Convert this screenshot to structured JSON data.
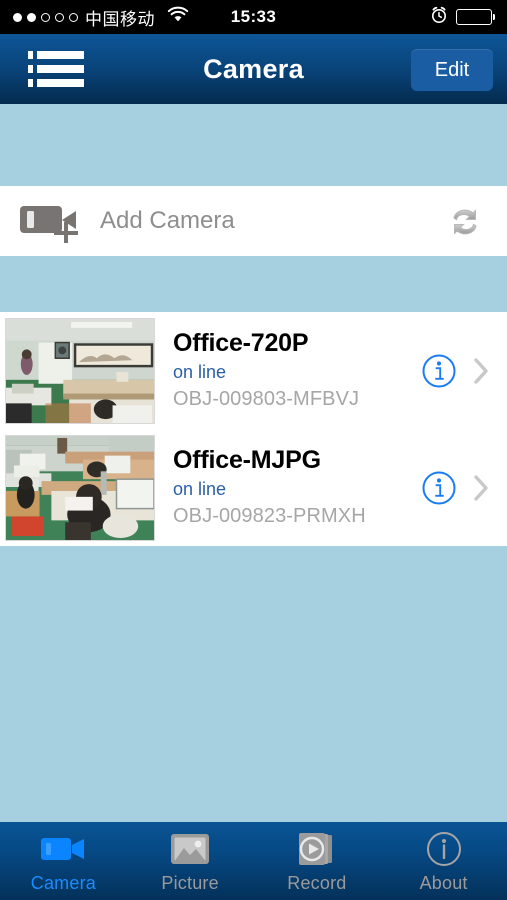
{
  "status_bar": {
    "signal_dots": [
      true,
      true,
      false,
      false,
      false
    ],
    "carrier": "中国移动",
    "wifi_icon": "wifi-icon",
    "time": "15:33",
    "alarm_icon": "alarm-clock-icon",
    "battery_icon": "battery-icon"
  },
  "nav": {
    "menu_icon": "list-menu-icon",
    "title": "Camera",
    "edit_label": "Edit"
  },
  "add_camera": {
    "icon": "camcorder-plus-icon",
    "label": "Add Camera",
    "refresh_icon": "refresh-sync-icon"
  },
  "cameras": [
    {
      "name": "Office-720P",
      "status": "on line",
      "serial": "OBJ-009803-MFBVJ",
      "info_icon": "info-circle-icon",
      "chevron_icon": "chevron-right-icon",
      "thumbnail": "office-room-snapshot"
    },
    {
      "name": "Office-MJPG",
      "status": "on line",
      "serial": "OBJ-009823-PRMXH",
      "info_icon": "info-circle-icon",
      "chevron_icon": "chevron-right-icon",
      "thumbnail": "office-desks-snapshot"
    }
  ],
  "tabs": [
    {
      "label": "Camera",
      "icon": "camcorder-icon",
      "active": true
    },
    {
      "label": "Picture",
      "icon": "picture-icon",
      "active": false
    },
    {
      "label": "Record",
      "icon": "play-stack-icon",
      "active": false
    },
    {
      "label": "About",
      "icon": "info-circle-icon",
      "active": false
    }
  ],
  "colors": {
    "background": "#a6cfdf",
    "nav_top": "#0d5697",
    "nav_bottom": "#042b4e",
    "accent_blue": "#1a8cff",
    "status_blue": "#2a5fa8",
    "serial_gray": "#a6a6a6",
    "edit_button": "#1a5da2"
  }
}
